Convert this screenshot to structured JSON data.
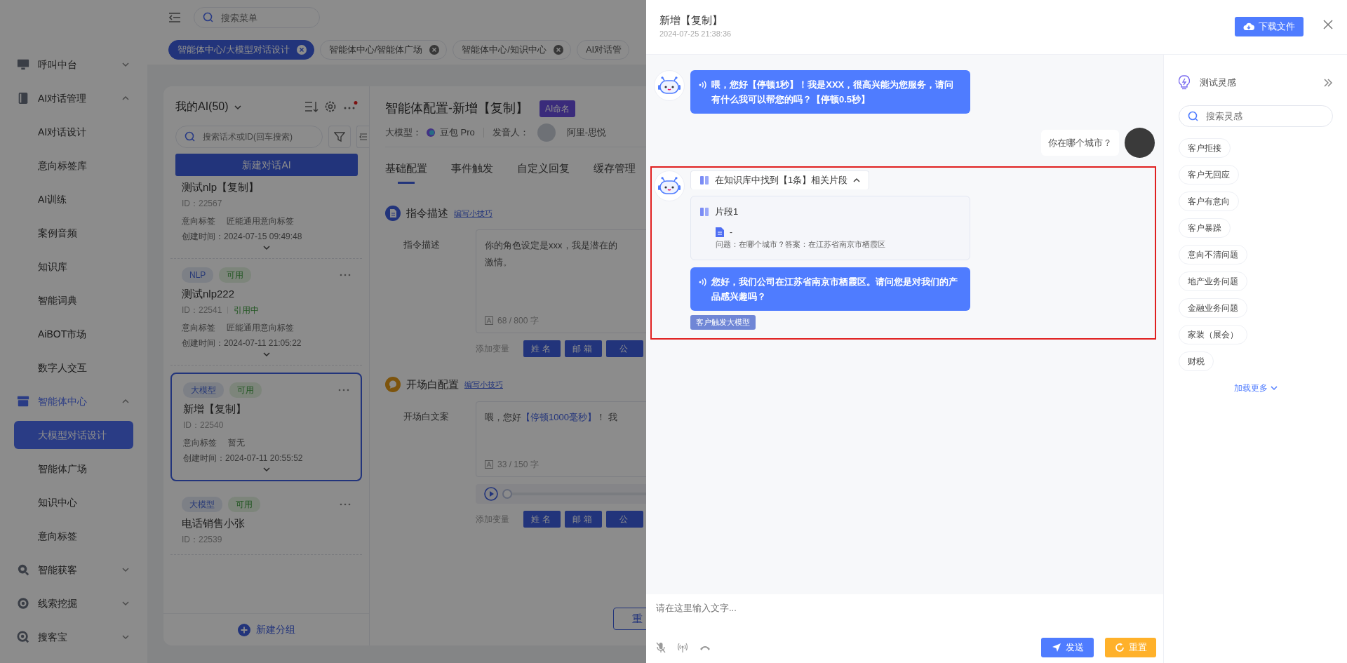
{
  "sidebar": {
    "groups": [
      {
        "label": "呼叫中台",
        "expanded": false
      },
      {
        "label": "AI对话管理",
        "expanded": true,
        "children": [
          {
            "label": "AI对话设计",
            "selected": false
          },
          {
            "label": "意向标签库",
            "selected": false
          },
          {
            "label": "AI训练",
            "selected": false
          },
          {
            "label": "案例音频",
            "selected": false
          },
          {
            "label": "知识库",
            "selected": false
          },
          {
            "label": "智能词典",
            "selected": false
          },
          {
            "label": "AiBOT市场",
            "selected": false
          },
          {
            "label": "数字人交互",
            "selected": false
          }
        ]
      },
      {
        "label": "智能体中心",
        "expanded": true,
        "children": [
          {
            "label": "大模型对话设计",
            "selected": true
          },
          {
            "label": "智能体广场",
            "selected": false
          },
          {
            "label": "知识中心",
            "selected": false
          },
          {
            "label": "意向标签",
            "selected": false
          }
        ]
      },
      {
        "label": "智能获客",
        "expanded": false
      },
      {
        "label": "线索挖掘",
        "expanded": false
      },
      {
        "label": "搜客宝",
        "expanded": false
      }
    ]
  },
  "topbar": {
    "search": {
      "placeholder": "搜索菜单"
    }
  },
  "tabs": [
    {
      "label": "智能体中心/大模型对话设计",
      "selected": true
    },
    {
      "label": "智能体中心/智能体广场",
      "selected": false
    },
    {
      "label": "智能体中心/知识中心",
      "selected": false
    },
    {
      "label": "AI对话管",
      "selected": false
    }
  ],
  "agent_list": {
    "title": "我的AI(50)",
    "search": {
      "placeholder": "搜索话术或ID(回车搜索)"
    },
    "new_button": "新建对话AI",
    "items": [
      {
        "selected": false,
        "name": "测试nlp【复制】",
        "id": "ID：22567",
        "intent_label": "意向标签",
        "intent": "匠能通用意向标签",
        "created": "创建时间：2024-07-15 09:49:48"
      },
      {
        "selected": false,
        "tags": [
          {
            "label": "NLP",
            "kind": "type"
          },
          {
            "label": "可用",
            "kind": "status"
          }
        ],
        "name": "测试nlp222",
        "id": "ID：22541",
        "usage": "引用中",
        "intent_label": "意向标签",
        "intent": "匠能通用意向标签",
        "created": "创建时间：2024-07-11 21:05:22"
      },
      {
        "selected": true,
        "tags": [
          {
            "label": "大模型",
            "kind": "type"
          },
          {
            "label": "可用",
            "kind": "status"
          }
        ],
        "name": "新增【复制】",
        "id": "ID：22540",
        "intent_label": "意向标签",
        "intent": "暂无",
        "created": "创建时间：2024-07-11 20:55:52"
      },
      {
        "selected": false,
        "tags": [
          {
            "label": "大模型",
            "kind": "type"
          },
          {
            "label": "可用",
            "kind": "status"
          }
        ],
        "name": "电话销售小张",
        "id": "ID：22539"
      }
    ],
    "add_group_button": "新建分组"
  },
  "config": {
    "title": "智能体配置-新增【复制】",
    "badge": "AI命名",
    "model_label": "大模型：",
    "model": "豆包 Pro",
    "speaker_label": "发音人：",
    "speaker": "阿里-思悦",
    "tabs": [
      {
        "label": "基础配置",
        "selected": true
      },
      {
        "label": "事件触发",
        "selected": false
      },
      {
        "label": "自定义回复",
        "selected": false
      },
      {
        "label": "缓存管理",
        "selected": false
      }
    ],
    "sections": [
      {
        "kind": "instruction",
        "title": "指令描述",
        "link": "编写小技巧",
        "field_label": "指令描述",
        "lines": [
          [
            {
              "text": "你的角色设定是xxx，我是潜在的",
              "kind": "plain"
            }
          ],
          [
            {
              "text": "激情。",
              "kind": "plain"
            }
          ]
        ],
        "counter": "68 / 800 字",
        "variables_label": "添加变量",
        "variables": [
          "姓名",
          "邮箱",
          "公"
        ]
      },
      {
        "kind": "opening",
        "title": "开场白配置",
        "link": "编写小技巧",
        "field_label": "开场白文案",
        "lines": [
          [
            {
              "text": "喂，您好",
              "kind": "plain"
            },
            {
              "text": "【停顿1000毫秒】",
              "kind": "pause"
            },
            {
              "text": "！ 我",
              "kind": "plain"
            }
          ]
        ],
        "counter": "33 / 150 字",
        "audio": {
          "level": 0
        },
        "variables_label": "添加变量",
        "variables": [
          "姓名",
          "邮箱",
          "公"
        ]
      }
    ],
    "reset_button": "重"
  },
  "drawer": {
    "title": "新增【复制】",
    "time": "2024-07-25 21:38:36",
    "download_button": "下载文件",
    "messages": [
      {
        "kind": "speech",
        "highlighted": false,
        "text": "喂，您好【停顿1秒】！我是XXX，很高兴能为您服务，请问有什么我可以帮您的吗？【停顿0.5秒】"
      },
      {
        "kind": "question",
        "highlighted": false,
        "text": "你在哪个城市？"
      },
      {
        "kind": "knowledge",
        "highlighted": true,
        "summary": "在知识库中找到【1条】相关片段",
        "expanded": true,
        "fragments": [
          {
            "title": "片段1",
            "doc": "-",
            "content": "问题：在哪个城市？答案：在江苏省南京市栖霞区"
          }
        ],
        "text": "您好，我们公司在江苏省南京市栖霞区。请问您是对我们的产品感兴趣吗？",
        "tag": "客户触发大模型"
      }
    ]
  },
  "inspiration": {
    "title": "测试灵感",
    "search": {
      "placeholder": "搜索灵感"
    },
    "chips": [
      "客户拒接",
      "客户无回应",
      "客户有意向",
      "客户暴躁",
      "意向不清问题",
      "地产业务问题",
      "金融业务问题",
      "家装（展会）",
      "财税"
    ],
    "load_more": "加载更多"
  },
  "composer": {
    "placeholder": "请在这里输入文字...",
    "send_button": "发送",
    "reset_button": "重置"
  }
}
